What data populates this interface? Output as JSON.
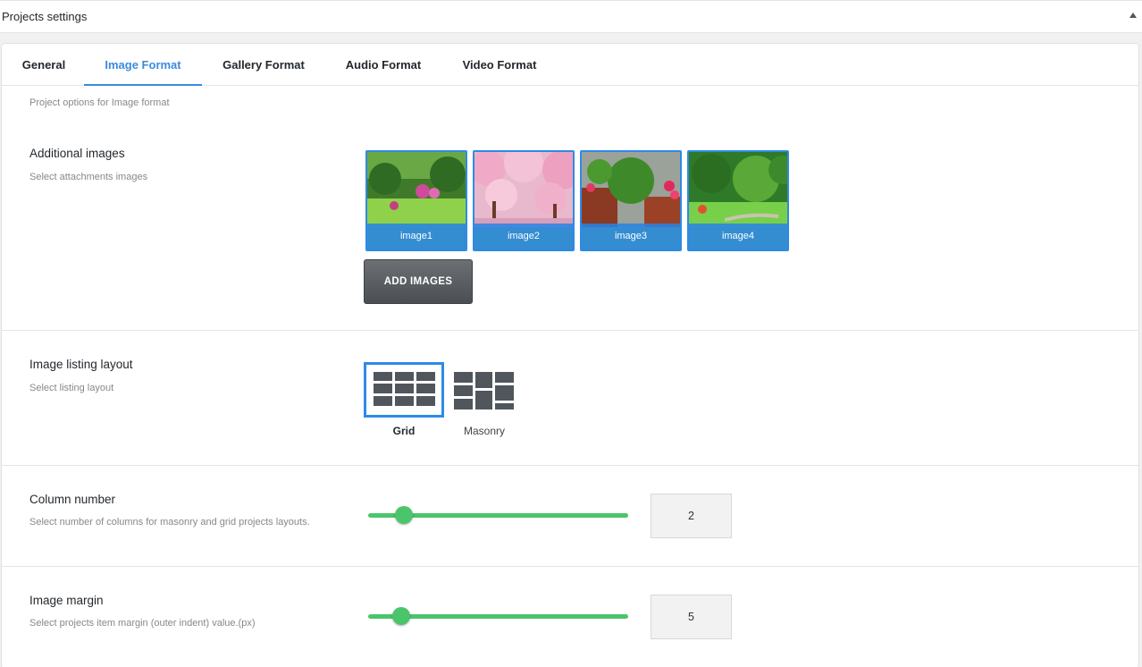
{
  "panel": {
    "title": "Projects settings"
  },
  "tabs": [
    {
      "label": "General",
      "active": false
    },
    {
      "label": "Image Format",
      "active": true
    },
    {
      "label": "Gallery Format",
      "active": false
    },
    {
      "label": "Audio Format",
      "active": false
    },
    {
      "label": "Video Format",
      "active": false
    }
  ],
  "intro": "Project options for Image format",
  "additional_images": {
    "title": "Additional images",
    "desc": "Select attachments images",
    "images": [
      "image1",
      "image2",
      "image3",
      "image4"
    ],
    "add_button": "ADD IMAGES"
  },
  "listing_layout": {
    "title": "Image listing layout",
    "desc": "Select listing layout",
    "options": [
      {
        "label": "Grid",
        "selected": true
      },
      {
        "label": "Masonry",
        "selected": false
      }
    ]
  },
  "column_number": {
    "title": "Column number",
    "desc": "Select number of columns for masonry and grid projects layouts.",
    "value": "2"
  },
  "image_margin": {
    "title": "Image margin",
    "desc": "Select projects item margin (outer indent) value.(px)",
    "value": "5"
  },
  "colors": {
    "accent": "#3b8be0",
    "slider": "#4cc46b",
    "icon": "#50565c"
  }
}
